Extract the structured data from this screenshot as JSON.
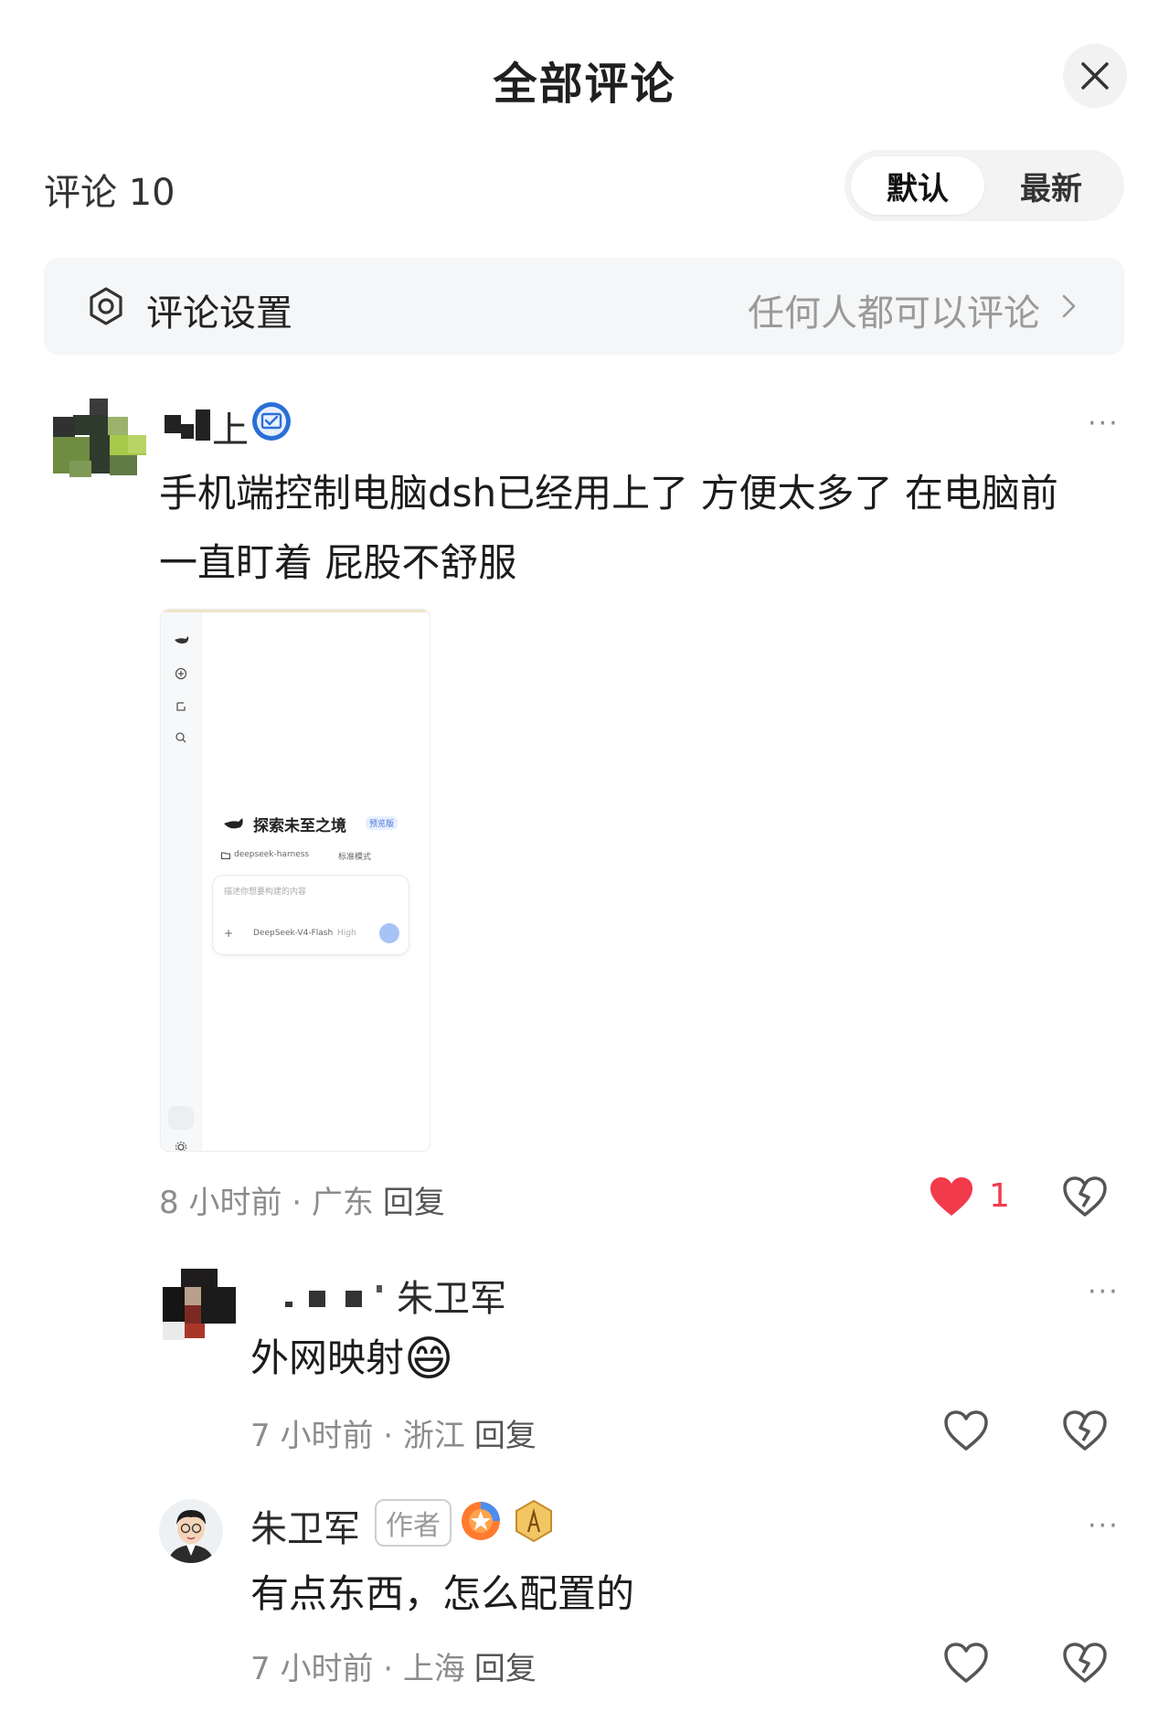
{
  "header": {
    "title": "全部评论",
    "close_icon": "close-icon"
  },
  "toolbar": {
    "count_label": "评论 10",
    "sort": {
      "default_label": "默认",
      "latest_label": "最新",
      "active": "默认"
    }
  },
  "settings": {
    "label": "评论设置",
    "value": "任何人都可以评论",
    "icon": "settings-ring-icon"
  },
  "comments": [
    {
      "author_suffix": "上",
      "verified_icon": "verified-badge-icon",
      "text_line1": "手机端控制电脑dsh已经用上了 方便太多了 在电脑前",
      "text_line2": "一直盯着 屁股不舒服",
      "meta": "8 小时前 · 广东",
      "reply_label": "回复",
      "likes": "1",
      "liked": true,
      "colors": {
        "like": "#f23a4d"
      },
      "image": {
        "title": "探索未至之境",
        "badge": "预览版",
        "folder": "deepseek-harness",
        "mode": "标准模式",
        "placeholder": "描述你想要构建的内容",
        "model": "DeepSeek-V4-Flash",
        "level": "High",
        "plus": "+"
      }
    },
    {
      "author_suffix": "朱卫军",
      "text": "外网映射",
      "emoji": "😄",
      "meta": "7 小时前 · 浙江",
      "reply_label": "回复"
    },
    {
      "author": "朱卫军",
      "author_badge": "作者",
      "text": "有点东西，怎么配置的",
      "meta": "7 小时前 · 上海",
      "reply_label": "回复"
    }
  ],
  "more_label": "···"
}
